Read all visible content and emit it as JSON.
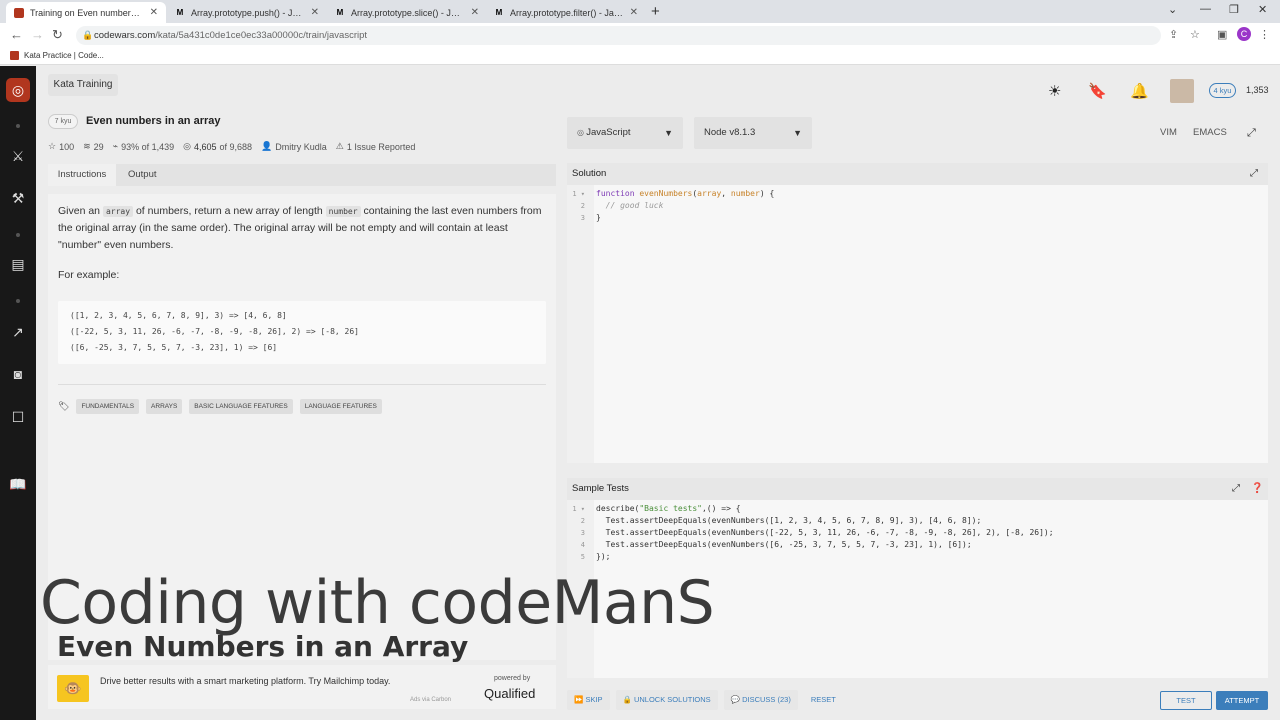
{
  "browser": {
    "tabs": [
      {
        "title": "Training on Even numbers in an a",
        "favicon": "codewars-icon"
      },
      {
        "title": "Array.prototype.push() - JavaScri",
        "favicon": "mdn-icon"
      },
      {
        "title": "Array.prototype.slice() - JavaScri",
        "favicon": "mdn-icon"
      },
      {
        "title": "Array.prototype.filter() - JavaScri",
        "favicon": "mdn-icon"
      }
    ],
    "url_host": "codewars.com",
    "url_path": "/kata/5a431c0de1ce0ec33a00000c/train/javascript",
    "profile_initial": "C",
    "bookmark": "Kata Practice | Code..."
  },
  "header": {
    "kata_training": "Kata Training",
    "kyu": "4 kyu",
    "honor": "1,353"
  },
  "kata": {
    "rank": "7 kyu",
    "title": "Even numbers in an array",
    "stats": {
      "stars": "100",
      "collections": "29",
      "satisfaction": "93% of 1,439",
      "completed": "4,605",
      "completed_of": " of 9,688",
      "author": "Dmitry Kudla",
      "issues": "1 Issue Reported"
    },
    "tabs": {
      "instructions": "Instructions",
      "output": "Output"
    },
    "desc": {
      "p1a": "Given an ",
      "code1": "array",
      "p1b": " of numbers, return a new array of length ",
      "code2": "number",
      "p1c": " containing the last even numbers from the original array (in the same order). The original array will be not empty and will contain at least \"number\" even numbers.",
      "p2": "For example:"
    },
    "examples": [
      "([1, 2, 3, 4, 5, 6, 7, 8, 9], 3) => [4, 6, 8]",
      "([-22, 5, 3, 11, 26, -6, -7, -8, -9, -8, 26], 2) => [-8, 26]",
      "([6, -25, 3, 7, 5, 5, 7, -3, 23], 1) => [6]"
    ],
    "tags": [
      "FUNDAMENTALS",
      "ARRAYS",
      "BASIC LANGUAGE FEATURES",
      "LANGUAGE FEATURES"
    ]
  },
  "ad": {
    "text": "Drive better results with a smart marketing platform. Try Mailchimp today.",
    "powered": "powered by",
    "brand": "Qualified",
    "via": "Ads via Carbon"
  },
  "editor": {
    "language": "JavaScript",
    "version": "Node v8.1.3",
    "vim": "VIM",
    "emacs": "EMACS",
    "solution_title": "Solution",
    "tests_title": "Sample Tests"
  },
  "actions": {
    "skip": "SKIP",
    "unlock": "UNLOCK SOLUTIONS",
    "discuss": "DISCUSS (23)",
    "reset": "RESET",
    "test": "TEST",
    "attempt": "ATTEMPT"
  },
  "overlay": {
    "title": "Coding with codeManS",
    "subtitle": "Even Numbers in an Array"
  }
}
